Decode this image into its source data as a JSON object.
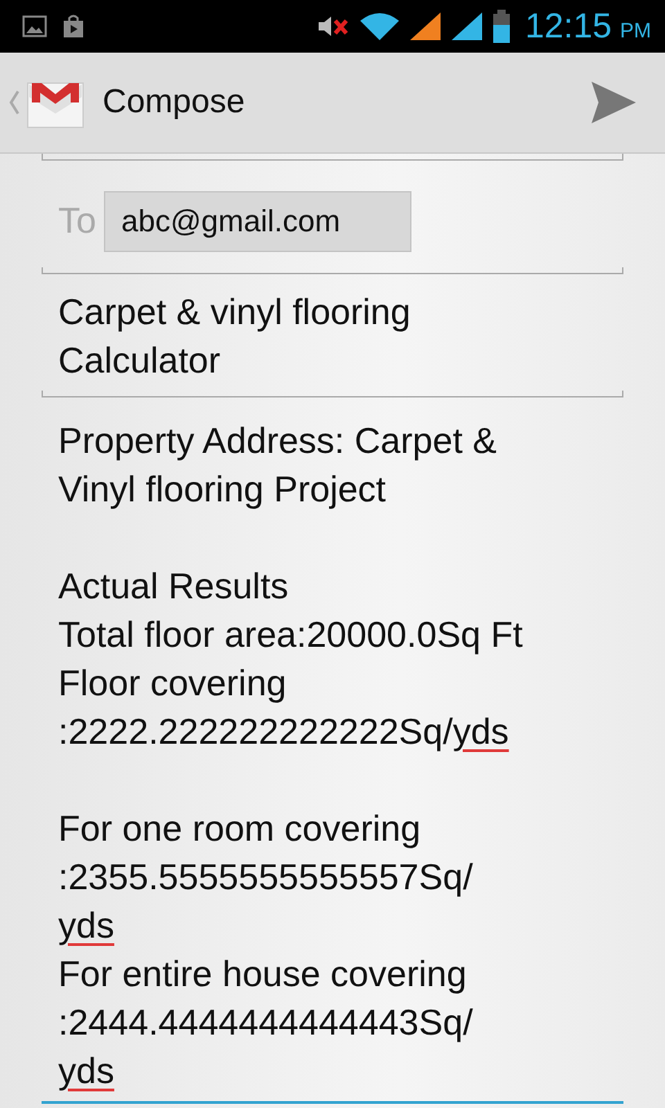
{
  "status_bar": {
    "time": "12:15",
    "ampm": "PM"
  },
  "action_bar": {
    "title": "Compose"
  },
  "to": {
    "label": "To",
    "recipients": [
      "abc@gmail.com"
    ]
  },
  "subject": {
    "lines": [
      "Carpet & vinyl flooring",
      "Calculator"
    ]
  },
  "body": {
    "focused": true,
    "paragraphs": [
      [
        [
          {
            "text": "Property Address: Carpet &",
            "misspelled": false
          }
        ],
        [
          {
            "text": "Vinyl flooring Project",
            "misspelled": false
          }
        ]
      ],
      [
        [
          {
            "text": "Actual Results",
            "misspelled": false
          }
        ],
        [
          {
            "text": "Total floor area:20000.0Sq Ft",
            "misspelled": false
          }
        ],
        [
          {
            "text": "Floor covering",
            "misspelled": false
          }
        ],
        [
          {
            "text": ":2222.222222222222Sq/",
            "misspelled": false
          },
          {
            "text": "yds",
            "misspelled": true
          }
        ]
      ],
      [
        [
          {
            "text": "For one room covering",
            "misspelled": false
          }
        ],
        [
          {
            "text": ":2355.5555555555557Sq/",
            "misspelled": false
          }
        ],
        [
          {
            "text": "yds",
            "misspelled": true
          }
        ],
        [
          {
            "text": "For entire house covering",
            "misspelled": false
          }
        ],
        [
          {
            "text": ":2444.4444444444443Sq/",
            "misspelled": false
          }
        ],
        [
          {
            "text": "yds",
            "misspelled": true
          }
        ]
      ]
    ]
  }
}
